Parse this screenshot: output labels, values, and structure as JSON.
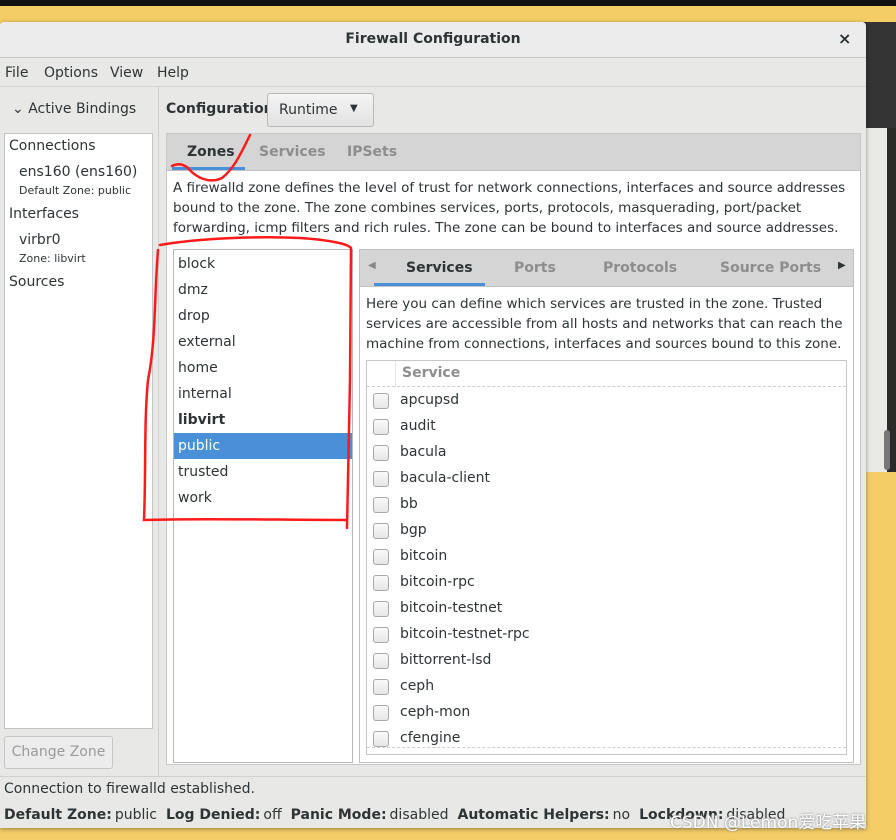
{
  "window": {
    "title": "Firewall Configuration",
    "close_icon": "close-icon"
  },
  "menu": [
    "File",
    "Options",
    "View",
    "Help"
  ],
  "bindings": {
    "header": "Active Bindings",
    "connections_label": "Connections",
    "connection": {
      "name": "ens160 (ens160)",
      "zone": "Default Zone: public"
    },
    "interfaces_label": "Interfaces",
    "interface": {
      "name": "virbr0",
      "zone": "Zone: libvirt"
    },
    "sources_label": "Sources",
    "change_zone": "Change Zone"
  },
  "configuration": {
    "label": "Configuration:",
    "value": "Runtime"
  },
  "tabs": [
    "Zones",
    "Services",
    "IPSets"
  ],
  "zones_description": "A firewalld zone defines the level of trust for network connections, interfaces and source addresses bound to the zone. The zone combines services, ports, protocols, masquerading, port/packet forwarding, icmp filters and rich rules. The zone can be bound to interfaces and source addresses.",
  "zones": [
    "block",
    "dmz",
    "drop",
    "external",
    "home",
    "internal",
    "libvirt",
    "public",
    "trusted",
    "work"
  ],
  "selected_zone": "public",
  "bold_zone": "libvirt",
  "zone_tabs": [
    "Services",
    "Ports",
    "Protocols",
    "Source Ports"
  ],
  "services_description": "Here you can define which services are trusted in the zone. Trusted services are accessible from all hosts and networks that can reach the machine from connections, interfaces and sources bound to this zone.",
  "service_header": "Service",
  "services": [
    "apcupsd",
    "audit",
    "bacula",
    "bacula-client",
    "bb",
    "bgp",
    "bitcoin",
    "bitcoin-rpc",
    "bitcoin-testnet",
    "bitcoin-testnet-rpc",
    "bittorrent-lsd",
    "ceph",
    "ceph-mon",
    "cfengine"
  ],
  "status": {
    "message": "Connection to firewalld established.",
    "items": [
      {
        "label": "Default Zone:",
        "value": "public"
      },
      {
        "label": "Log Denied:",
        "value": "off"
      },
      {
        "label": "Panic Mode:",
        "value": "disabled"
      },
      {
        "label": "Automatic Helpers:",
        "value": "no"
      },
      {
        "label": "Lockdown:",
        "value": "disabled"
      }
    ]
  },
  "watermark": "CSDN @Lemon爱吃苹果",
  "colors": {
    "accent": "#4a90d9",
    "annotation": "#ff0000"
  }
}
